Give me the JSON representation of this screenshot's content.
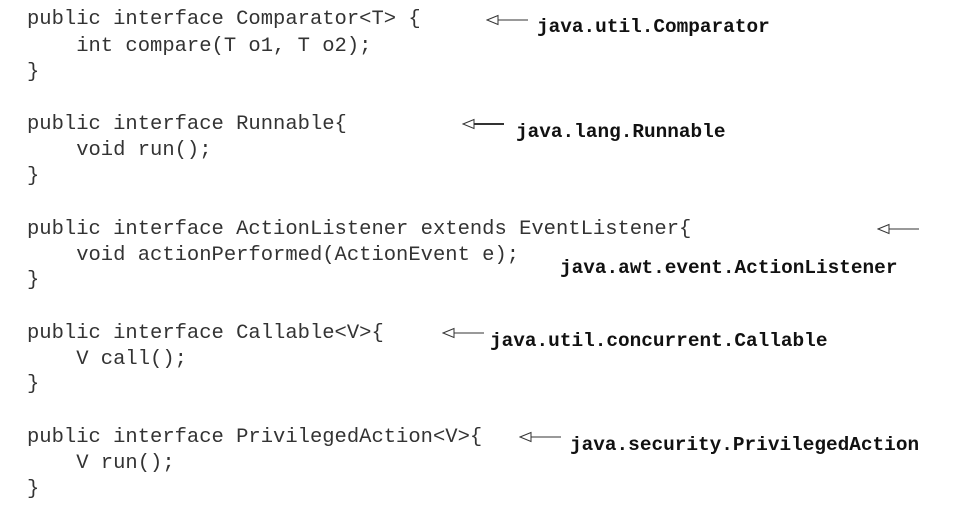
{
  "blocks": [
    {
      "lines": [
        "public interface Comparator<T> {",
        "    int compare(T o1, T o2);",
        "}"
      ],
      "annotation": "java.util.Comparator"
    },
    {
      "lines": [
        "public interface Runnable{",
        "    void run();",
        "}"
      ],
      "annotation": "java.lang.Runnable"
    },
    {
      "lines": [
        "public interface ActionListener extends EventListener{",
        "    void actionPerformed(ActionEvent e);",
        "}"
      ],
      "annotation": "java.awt.event.ActionListener"
    },
    {
      "lines": [
        "public interface Callable<V>{",
        "    V call();",
        "}"
      ],
      "annotation": "java.util.concurrent.Callable"
    },
    {
      "lines": [
        "public interface PrivilegedAction<V>{",
        "    V run();",
        "}"
      ],
      "annotation": "java.security.PrivilegedAction"
    }
  ]
}
